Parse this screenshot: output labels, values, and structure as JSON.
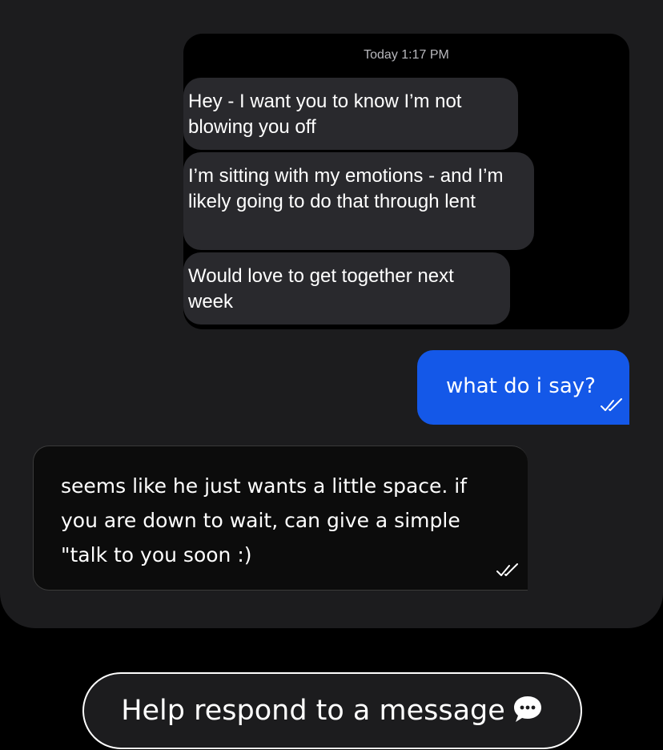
{
  "conversation_screenshot": {
    "timestamp": "Today 1:17 PM",
    "messages": [
      "Hey - I want you to know I’m not blowing you off",
      "I’m sitting with my emotions - and I’m likely going to do that through lent",
      "Would love to get together next week"
    ]
  },
  "chat": {
    "user_message": "what do i say?",
    "assistant_message": "seems like he just wants a little space. if you are down to wait, can give a simple \"talk to you soon :)",
    "read_status_icon": "double-check-icon"
  },
  "action": {
    "label": "Help respond to a message",
    "icon": "speech-bubble-icon"
  },
  "colors": {
    "user_bubble": "#1458e8",
    "panel_background": "#1c1c1e",
    "received_bubble": "#29292d"
  }
}
